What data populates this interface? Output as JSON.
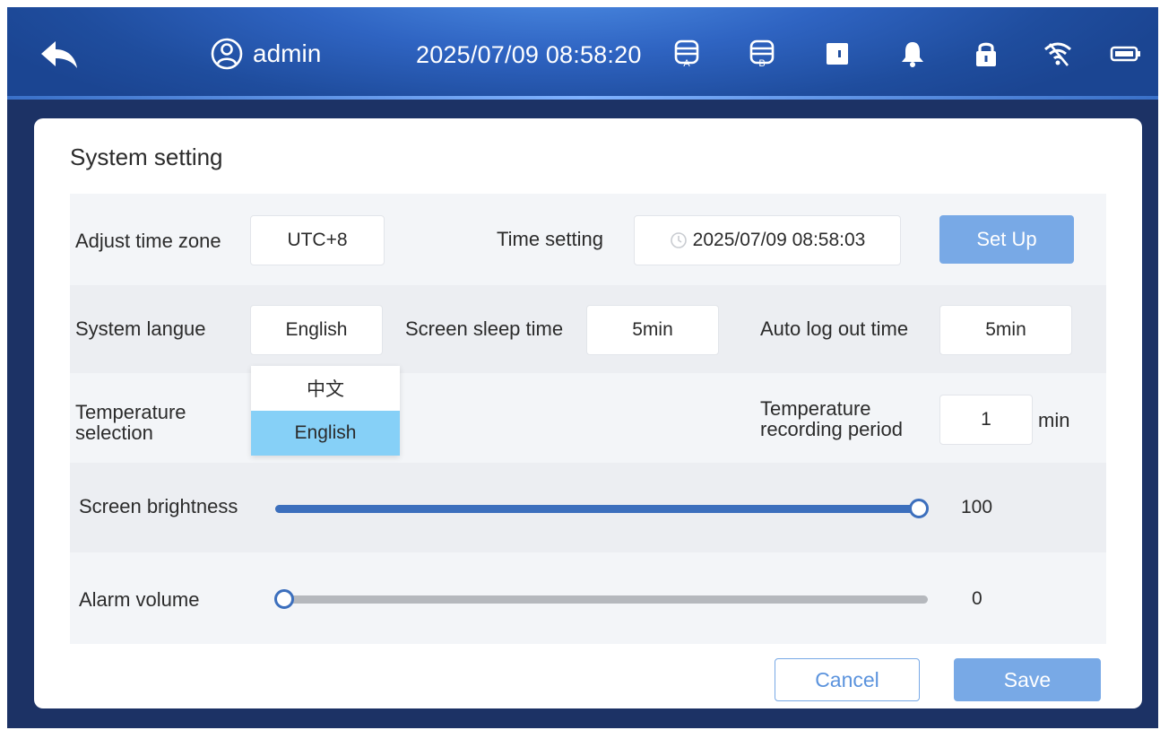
{
  "header": {
    "username": "admin",
    "datetime": "2025/07/09 08:58:20",
    "icons": [
      "back-arrow-icon",
      "user-icon",
      "storage-a-icon",
      "storage-b-icon",
      "door-icon",
      "bell-icon",
      "lock-icon",
      "wifi-icon",
      "battery-icon"
    ],
    "storage_a_letter": "A",
    "storage_b_letter": "B"
  },
  "panel": {
    "title": "System setting"
  },
  "settings": {
    "timezone_label": "Adjust time zone",
    "timezone_value": "UTC+8",
    "time_setting_label": "Time setting",
    "time_setting_value": "2025/07/09 08:58:03",
    "setup_button": "Set Up",
    "language_label": "System langue",
    "language_value": "English",
    "language_options": [
      "中文",
      "English"
    ],
    "language_selected": "English",
    "screen_sleep_label": "Screen sleep time",
    "screen_sleep_value": "5min",
    "auto_logout_label": "Auto log out time",
    "auto_logout_value": "5min",
    "temperature_selection_label_line1": "Temperature",
    "temperature_selection_label_line2": "selection",
    "temp_period_label_line1": "Temperature",
    "temp_period_label_line2": "recording period",
    "temp_period_value": "1",
    "temp_period_unit": "min",
    "brightness_label": "Screen brightness",
    "brightness_value": "100",
    "brightness_fraction": 1.0,
    "volume_label": "Alarm volume",
    "volume_value": "0",
    "volume_fraction": 0.0
  },
  "footer": {
    "cancel_label": "Cancel",
    "save_label": "Save"
  },
  "colors": {
    "header_bg": "#2f64c2",
    "accent": "#78a9e6",
    "slider_fill": "#3c6fbd",
    "dropdown_selected": "#86d0f7"
  }
}
